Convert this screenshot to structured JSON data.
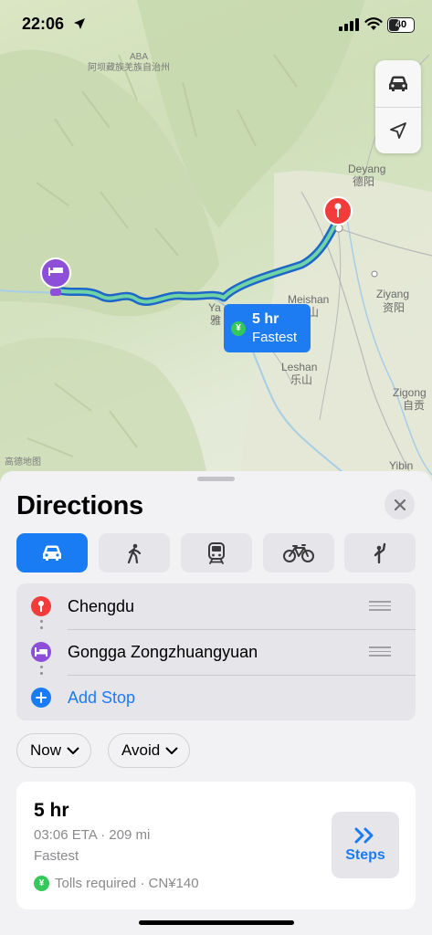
{
  "status_bar": {
    "time": "22:06",
    "battery": "40",
    "battery_level": 0.4
  },
  "map": {
    "labels": {
      "aba_1": "ABA",
      "aba_2": "阿坝藏族羌族自治州",
      "deyang_en": "Deyang",
      "deyang_zh": "德阳",
      "ziyang_en": "Ziyang",
      "ziyang_zh": "资阳",
      "meishan_en": "Meishan",
      "meishan_zh": "眉山",
      "leshan_en": "Leshan",
      "leshan_zh": "乐山",
      "zigong_en": "Zigong",
      "zigong_zh": "自贡",
      "yibin_en": "Yibin",
      "ya_en": "Ya",
      "ya_zh": "雅",
      "attribution": "高德地图"
    },
    "controls": {
      "mode_icon": "car-icon",
      "locate_icon": "location-arrow-icon"
    },
    "route_callout": {
      "duration": "5 hr",
      "tag": "Fastest",
      "toll_icon": "yen-icon"
    }
  },
  "sheet": {
    "title": "Directions",
    "close_icon": "close-icon",
    "transport_modes": [
      {
        "name": "drive",
        "icon": "car-icon",
        "active": true
      },
      {
        "name": "walk",
        "icon": "walk-icon",
        "active": false
      },
      {
        "name": "transit",
        "icon": "train-icon",
        "active": false
      },
      {
        "name": "cycle",
        "icon": "bicycle-icon",
        "active": false
      },
      {
        "name": "ride",
        "icon": "hail-icon",
        "active": false
      }
    ],
    "stops": [
      {
        "label": "Chengdu",
        "icon": "red-pin-icon"
      },
      {
        "label": "Gongga Zongzhuangyuan",
        "icon": "bed-icon"
      }
    ],
    "add_stop_label": "Add Stop",
    "options": {
      "now_label": "Now",
      "avoid_label": "Avoid"
    },
    "route": {
      "duration": "5 hr",
      "eta_distance": "03:06 ETA · 209 mi",
      "tag": "Fastest",
      "tolls": "Tolls required · CN¥140",
      "steps_label": "Steps"
    }
  },
  "colors": {
    "accent": "#1a7cf5",
    "route": "#1e7cf2",
    "route_highlight": "#5ac8fa",
    "pin_red": "#f23b3b",
    "hotel_purple": "#8e4fd8",
    "toll_green": "#34c759"
  }
}
